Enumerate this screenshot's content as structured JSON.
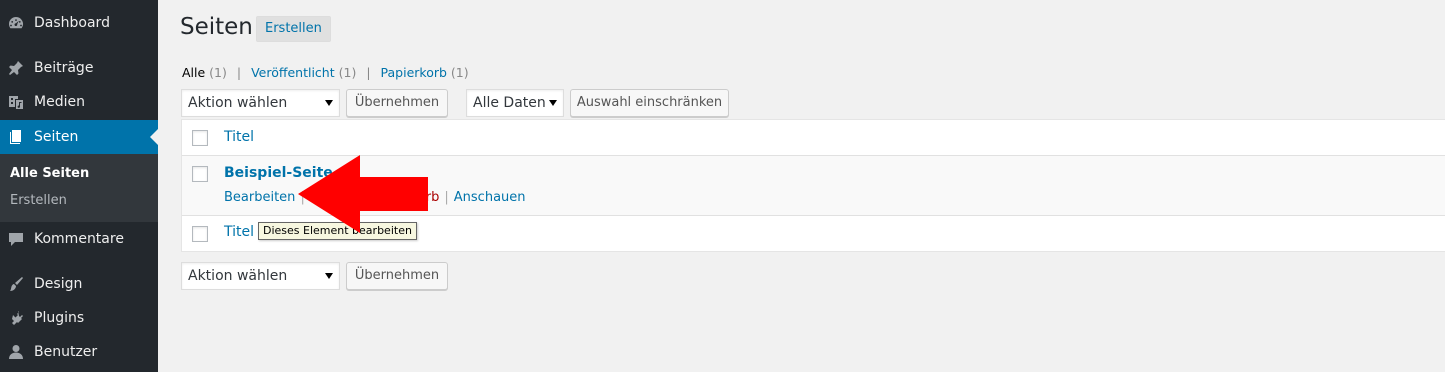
{
  "sidebar": {
    "items": [
      {
        "label": "Dashboard",
        "icon": "dashboard-icon"
      },
      {
        "label": "Beiträge",
        "icon": "pin-icon"
      },
      {
        "label": "Medien",
        "icon": "media-icon"
      },
      {
        "label": "Seiten",
        "icon": "pages-icon",
        "active": true
      },
      {
        "label": "Kommentare",
        "icon": "comment-icon"
      },
      {
        "label": "Design",
        "icon": "paintbrush-icon"
      },
      {
        "label": "Plugins",
        "icon": "plugin-icon"
      },
      {
        "label": "Benutzer",
        "icon": "user-icon"
      }
    ],
    "submenu": [
      {
        "label": "Alle Seiten",
        "current": true
      },
      {
        "label": "Erstellen"
      }
    ],
    "accent": "#0073aa"
  },
  "header": {
    "title": "Seiten",
    "add_new": "Erstellen"
  },
  "filters": {
    "all_label": "Alle",
    "all_count": "(1)",
    "published_label": "Veröffentlicht",
    "published_count": "(1)",
    "trash_label": "Papierkorb",
    "trash_count": "(1)",
    "sep": "|"
  },
  "toolbar_top": {
    "bulk_action": "Aktion wählen",
    "apply": "Übernehmen",
    "dates": "Alle Daten",
    "filter": "Auswahl einschränken"
  },
  "table": {
    "column_title": "Titel",
    "rows": [
      {
        "title": "Beispiel-Seite",
        "actions": {
          "edit": "Bearbeiten",
          "trash_partial": "orb",
          "view": "Anschauen",
          "sep": "|"
        }
      }
    ],
    "footer_title": "Titel"
  },
  "tooltip": "Dieses Element bearbeiten",
  "toolbar_bottom": {
    "bulk_action": "Aktion wählen",
    "apply": "Übernehmen"
  }
}
